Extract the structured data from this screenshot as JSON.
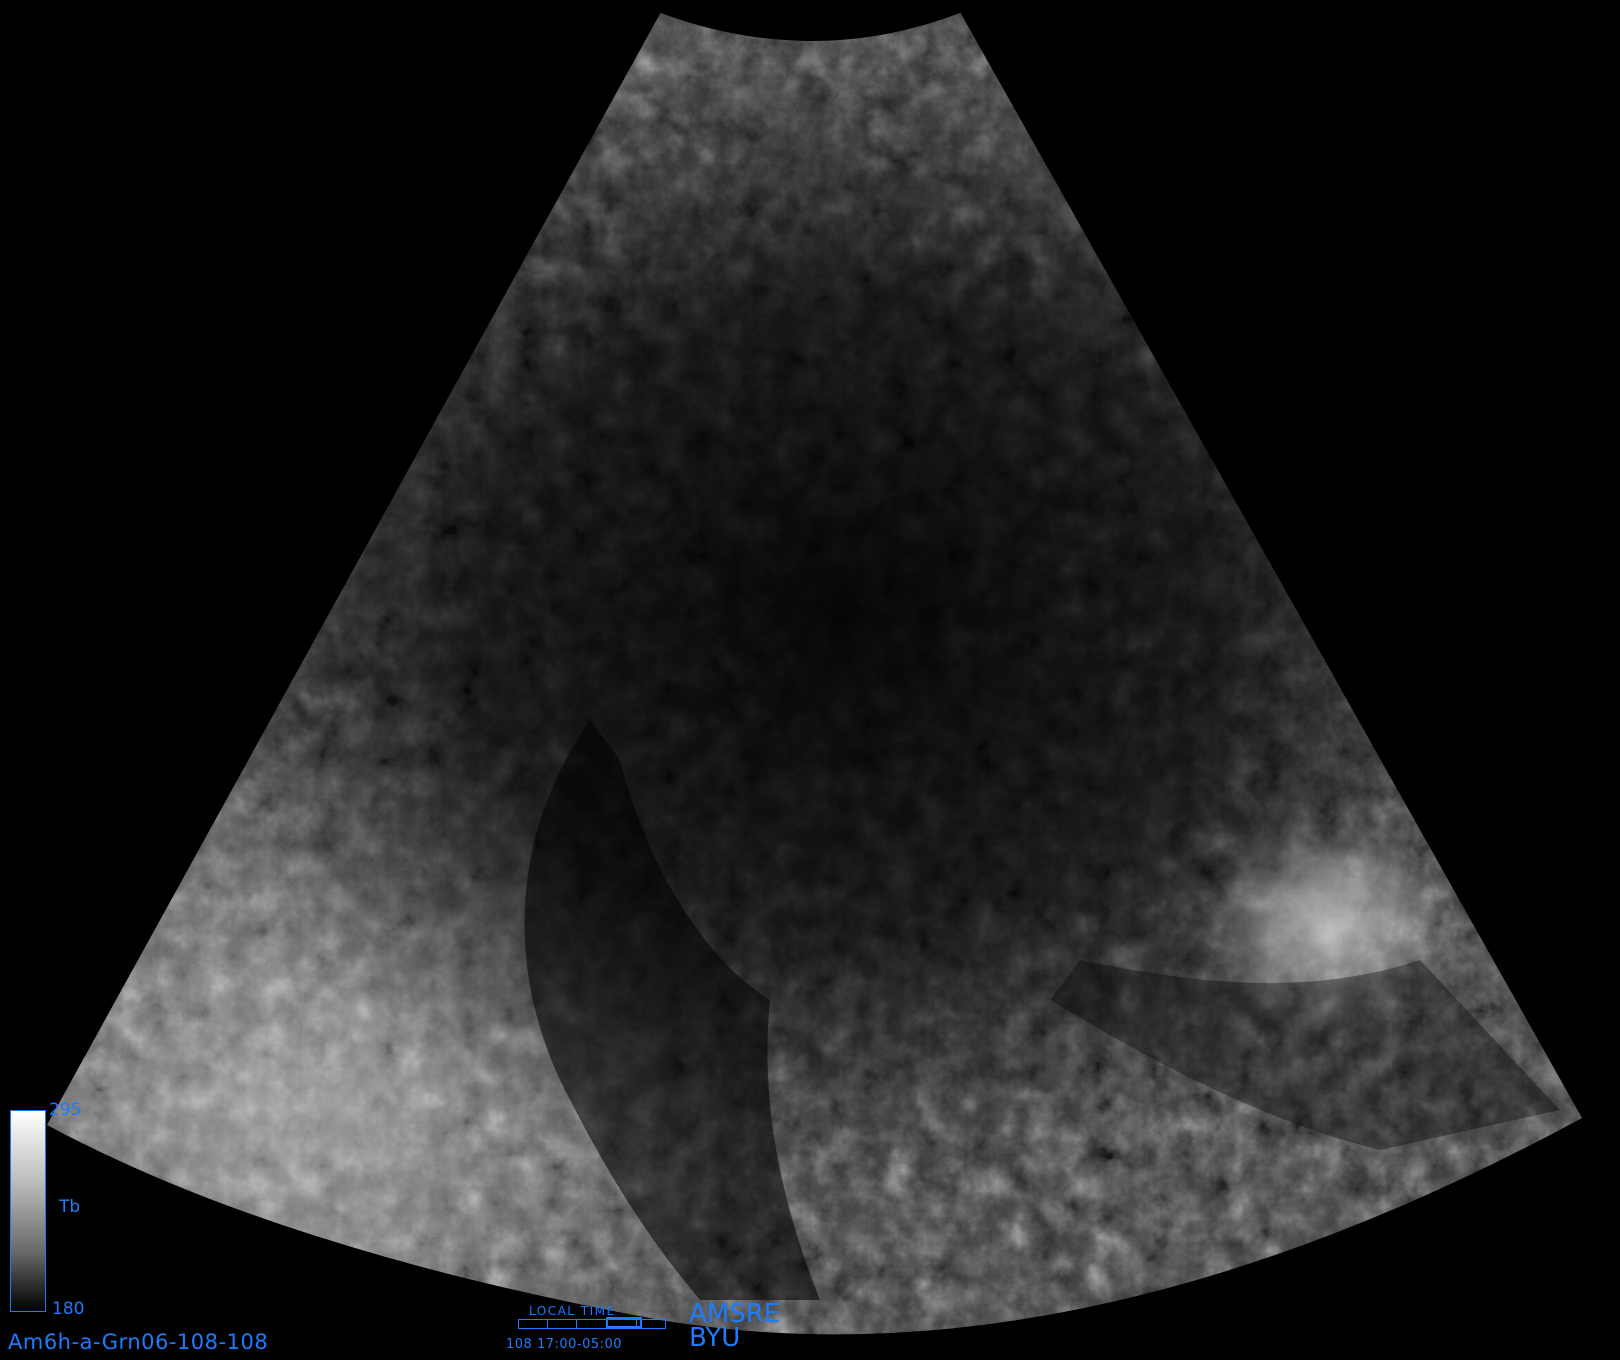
{
  "colorbar": {
    "max": "295",
    "variable": "Tb",
    "min": "180",
    "color_top": "#ffffff",
    "color_bottom": "#000000",
    "frame_color": "#1c7bff"
  },
  "product_id": "Am6h-a-Grn06-108-108",
  "time": {
    "label": "LOCAL TIME",
    "readout": "108 17:00-05:00"
  },
  "sensor": {
    "name": "AMSRE",
    "institution": "BYU"
  },
  "image": {
    "description_color_scale": "grayscale brightness temperature",
    "annotation_color": "#1c7bff"
  }
}
